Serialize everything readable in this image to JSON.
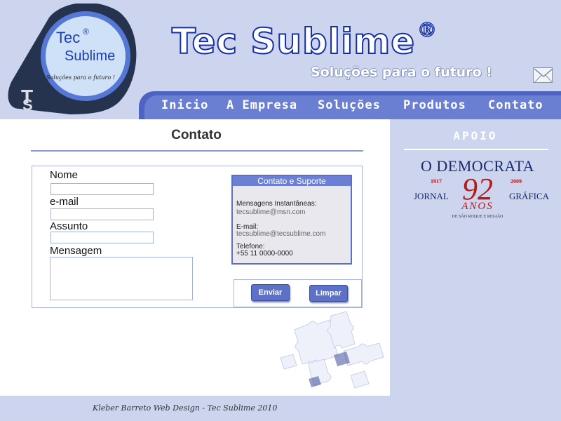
{
  "brand": {
    "badge_line1": "Tec",
    "badge_mark": "®",
    "badge_line2": "Sublime",
    "badge_slogan": "Soluções para o futuro !",
    "title": "Tec Sublime",
    "title_mark": "®",
    "slogan": "Soluções para o futuro !"
  },
  "nav": {
    "items": [
      "Inicio",
      "A Empresa",
      "Soluções",
      "Produtos",
      "Contato"
    ]
  },
  "page": {
    "title": "Contato"
  },
  "form": {
    "name_label": "Nome",
    "name_value": "",
    "email_label": "e-mail",
    "email_value": "",
    "subject_label": "Assunto",
    "subject_value": "",
    "message_label": "Mensagem",
    "message_value": "",
    "submit_label": "Enviar",
    "clear_label": "Limpar"
  },
  "support": {
    "title": "Contato e Suporte",
    "im_label": "Mensagens Instantâneas:",
    "im_value": "tecsublime@msn.com",
    "email_label": "E-mail:",
    "email_value": "tecsublime@tecsublime.com",
    "phone_label": "Telefone:",
    "phone_value": "+55 11 0000-0000"
  },
  "sidebar": {
    "title": "APOIO",
    "sponsor": {
      "name": "O DEMOCRATA",
      "year_start": "1917",
      "year_end": "2009",
      "left_word": "JORNAL",
      "right_word": "GRÁFICA",
      "number": "92",
      "anos": "ANOS",
      "subtitle": "DE SÃO ROQUE E REGIÃO"
    }
  },
  "footer": {
    "text": "Kleber Barreto Web Design - Tec Sublime 2010"
  },
  "colors": {
    "header_bg": "#ccd4ee",
    "nav_bg": "#6a7fd2",
    "title_stroke": "#1630a4",
    "button_bg": "#5d71c7",
    "sponsor_red": "#b41c1c"
  }
}
